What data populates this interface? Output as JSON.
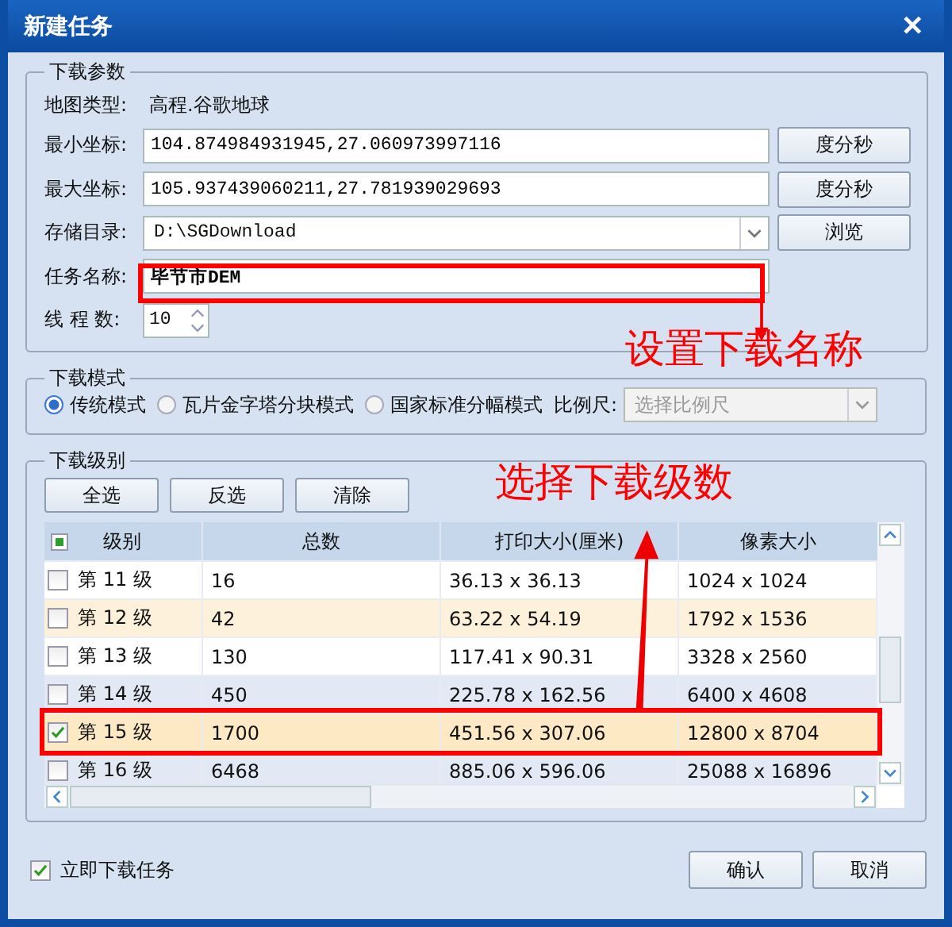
{
  "window": {
    "title": "新建任务",
    "close": "✕"
  },
  "params": {
    "legend": "下载参数",
    "map_type_label": "地图类型:",
    "map_type": "高程.谷歌地球",
    "min_label": "最小坐标:",
    "min_value": "104.874984931945,27.060973997116",
    "min_button": "度分秒",
    "max_label": "最大坐标:",
    "max_value": "105.937439060211,27.781939029693",
    "max_button": "度分秒",
    "dir_label": "存储目录:",
    "dir_value": "D:\\SGDownload",
    "browse_button": "浏览",
    "name_label": "任务名称:",
    "name_value": "毕节市DEM",
    "threads_label": "线 程 数:",
    "threads_value": "10"
  },
  "mode": {
    "legend": "下载模式",
    "options": [
      {
        "label": "传统模式",
        "selected": true
      },
      {
        "label": "瓦片金字塔分块模式",
        "selected": false
      },
      {
        "label": "国家标准分幅模式",
        "selected": false
      }
    ],
    "scale_label": "比例尺:",
    "scale_placeholder": "选择比例尺"
  },
  "levels": {
    "legend": "下载级别",
    "buttons": [
      "全选",
      "反选",
      "清除"
    ],
    "columns": [
      "级别",
      "总数",
      "打印大小(厘米)",
      "像素大小"
    ],
    "header_checked": true,
    "rows": [
      {
        "level": "第 11 级",
        "total": "16",
        "print": "36.13 x 36.13",
        "pixels": "1024 x 1024",
        "checked": false,
        "selected": false,
        "hovered": false
      },
      {
        "level": "第 12 级",
        "total": "42",
        "print": "63.22 x 54.19",
        "pixels": "1792 x 1536",
        "checked": false,
        "selected": false,
        "hovered": true
      },
      {
        "level": "第 13 级",
        "total": "130",
        "print": "117.41 x 90.31",
        "pixels": "3328 x 2560",
        "checked": false,
        "selected": false,
        "hovered": false
      },
      {
        "level": "第 14 级",
        "total": "450",
        "print": "225.78 x 162.56",
        "pixels": "6400 x 4608",
        "checked": false,
        "selected": false,
        "hovered": false
      },
      {
        "level": "第 15 级",
        "total": "1700",
        "print": "451.56 x 307.06",
        "pixels": "12800 x 8704",
        "checked": true,
        "selected": true,
        "hovered": false
      },
      {
        "level": "第 16 级",
        "total": "6468",
        "print": "885.06 x 596.06",
        "pixels": "25088 x 16896",
        "checked": false,
        "selected": false,
        "hovered": false
      }
    ]
  },
  "footer": {
    "download_now": {
      "label": "立即下载任务",
      "checked": true
    },
    "buttons": [
      "确认",
      "取消"
    ]
  },
  "annotations": [
    {
      "text": "设置下载名称"
    },
    {
      "text": "选择下载级数"
    }
  ]
}
